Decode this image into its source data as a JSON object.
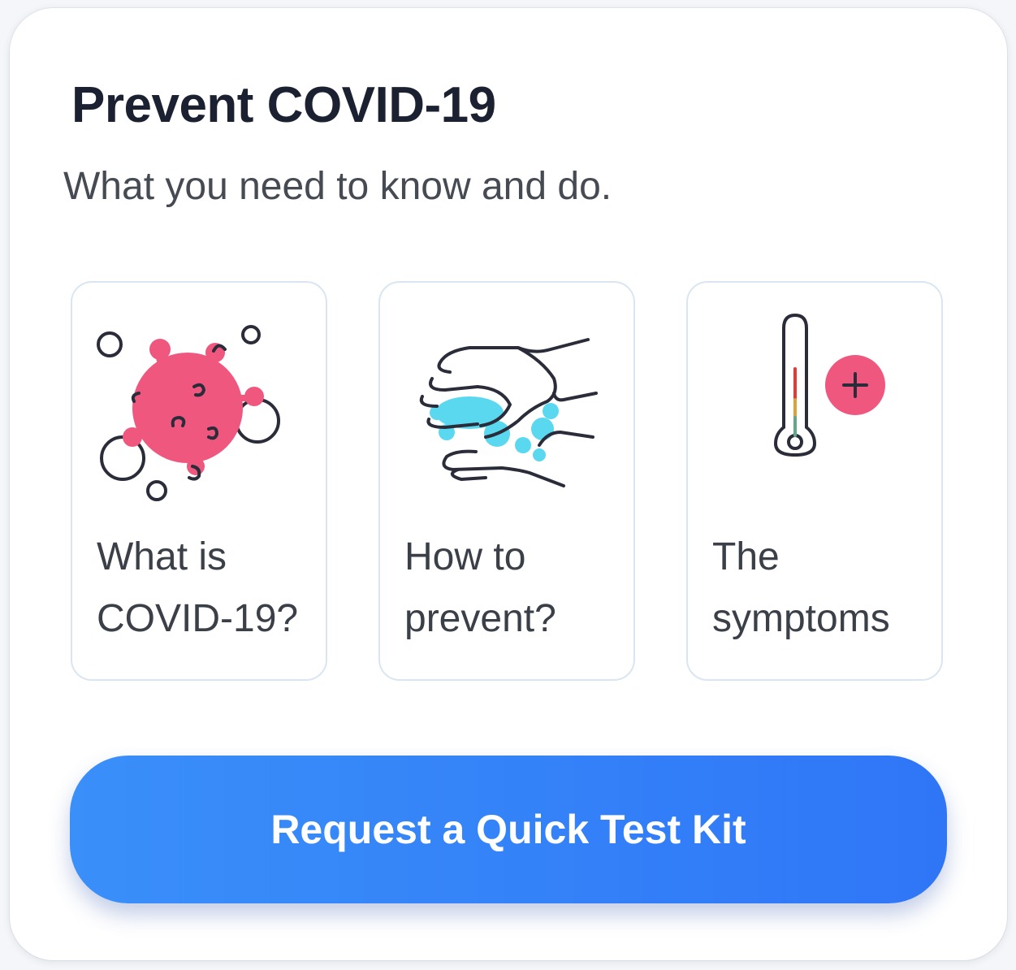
{
  "card": {
    "title": "Prevent COVID-19",
    "subtitle": "What you need to know and do."
  },
  "tiles": [
    {
      "label": "What is\nCOVID-19?",
      "icon": "virus-icon"
    },
    {
      "label": "How to\nprevent?",
      "icon": "hand-washing-icon"
    },
    {
      "label": "The\nsymptoms",
      "icon": "thermometer-icon"
    }
  ],
  "cta": {
    "label": "Request a Quick Test Kit"
  },
  "colors": {
    "accent_blue": "#2f76f7",
    "virus_pink": "#f0577f",
    "soap_cyan": "#5ad8f0",
    "text_dark": "#1b2130"
  }
}
